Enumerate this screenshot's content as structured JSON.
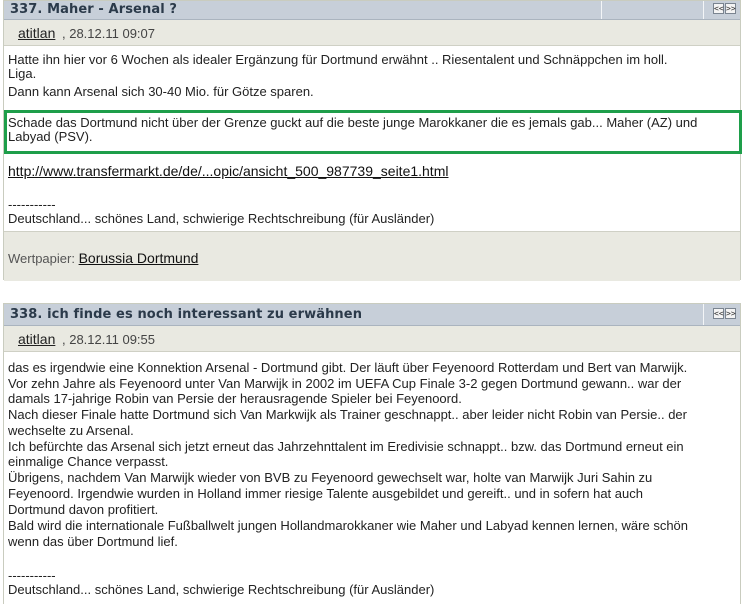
{
  "nav": {
    "prev": "<<",
    "next": ">>"
  },
  "post1": {
    "title": "337. Maher - Arsenal ?",
    "author": "atitlan",
    "date": ", 28.12.11 09:07",
    "lines": [
      "Hatte ihn hier vor 6 Wochen als idealer Ergänzung für Dortmund erwähnt .. Riesentalent und Schnäppchen im holl.",
      "Liga.",
      "Dann kann Arsenal sich 30-40 Mio. für Götze sparen."
    ],
    "highlight_lines": [
      "Schade das Dortmund nicht über der Grenze guckt auf die beste junge Marokkaner die es jemals gab... Maher (AZ) und",
      "Labyad (PSV)."
    ],
    "link": "http://www.transfermarkt.de/de/...opic/ansicht_500_987739_seite1.html",
    "sig_sep": "-----------",
    "sig": "Deutschland... schönes Land, schwierige Rechtschreibung (für Ausländer)",
    "wertpapier_label": "Wertpapier: ",
    "wertpapier_link": "Borussia Dortmund"
  },
  "post2": {
    "title": "338. ich finde es noch interessant zu erwähnen",
    "author": "atitlan",
    "date": ", 28.12.11 09:55",
    "lines": [
      "das es irgendwie eine Konnektion Arsenal - Dortmund gibt. Der läuft über Feyenoord Rotterdam und Bert van Marwijk.",
      "Vor zehn Jahre als Feyenoord unter Van Marwijk in 2002 im UEFA Cup Finale 3-2 gegen Dortmund gewann.. war der",
      "damals 17-jahrige Robin van Persie der herausragende Spieler bei Feyenoord.",
      "Nach dieser Finale hatte Dortmund sich Van Markwijk als Trainer geschnappt.. aber leider nicht Robin van Persie.. der",
      "wechselte zu Arsenal.",
      "Ich befürchte das Arsenal sich jetzt erneut das Jahrzehnttalent im Eredivisie schnappt.. bzw. das Dortmund erneut ein",
      "einmalige Chance verpasst.",
      "Übrigens, nachdem Van Marwijk wieder von BVB zu Feyenoord gewechselt war, holte van Marwijk  Juri Sahin zu",
      "Feyenoord.  Irgendwie wurden in Holland immer riesige Talente ausgebildet und gereift.. und in sofern hat auch",
      "Dortmund davon profitiert.",
      "Bald  wird die internationale Fußballwelt jungen Hollandmarokkaner wie Maher und Labyad kennen lernen, wäre schön",
      "wenn das über Dortmund lief."
    ],
    "sig_sep": "-----------",
    "sig": "Deutschland... schönes Land, schwierige Rechtschreibung (für Ausländer)"
  }
}
